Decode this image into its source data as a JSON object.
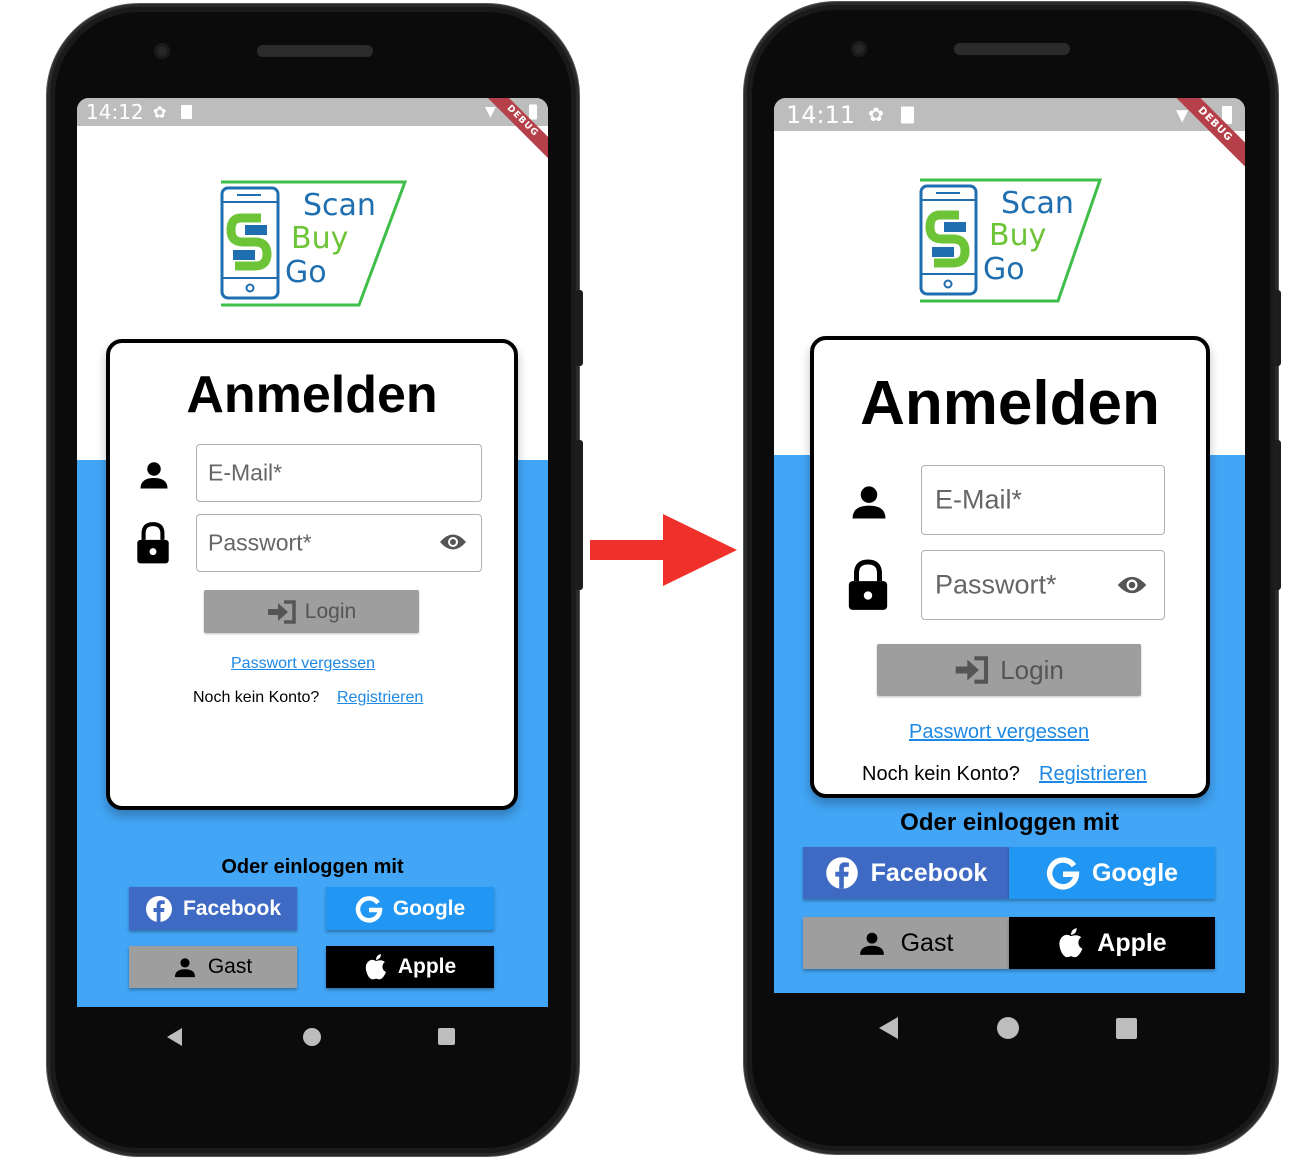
{
  "left": {
    "status_time": "14:12",
    "debug_label": "DEBUG",
    "logo": {
      "line1": "Scan",
      "line2": "Buy",
      "line3": "Go"
    },
    "title": "Anmelden",
    "email_placeholder": "E-Mail*",
    "password_placeholder": "Passwort*",
    "login_label": "Login",
    "forgot_label": "Passwort vergessen",
    "no_account_label": "Noch kein Konto?",
    "register_label": "Registrieren",
    "or_label": "Oder einloggen mit",
    "facebook_label": "Facebook",
    "google_label": "Google",
    "guest_label": "Gast",
    "apple_label": "Apple"
  },
  "right": {
    "status_time": "14:11",
    "debug_label": "DEBUG",
    "logo": {
      "line1": "Scan",
      "line2": "Buy",
      "line3": "Go"
    },
    "title": "Anmelden",
    "email_placeholder": "E-Mail*",
    "password_placeholder": "Passwort*",
    "login_label": "Login",
    "forgot_label": "Passwort vergessen",
    "no_account_label": "Noch kein Konto?",
    "register_label": "Registrieren",
    "or_label": "Oder einloggen mit",
    "facebook_label": "Facebook",
    "google_label": "Google",
    "guest_label": "Gast",
    "apple_label": "Apple"
  },
  "colors": {
    "accent_blue": "#42a5f5",
    "facebook": "#3f6ac4",
    "google": "#2196f3",
    "guest": "#9e9e9e",
    "apple": "#000000",
    "arrow": "#f0302a"
  }
}
